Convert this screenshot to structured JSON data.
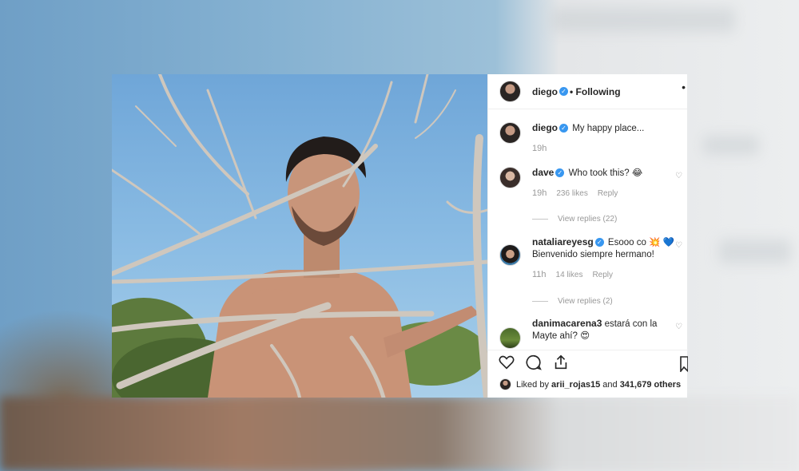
{
  "post": {
    "author": "diego",
    "follow_status": "• Following",
    "more_icon": "more-dots-icon",
    "caption": "My happy place...",
    "caption_time": "19h",
    "comments": [
      {
        "user": "dave",
        "verified": true,
        "text": "Who took this? 😂",
        "time": "19h",
        "likes": "236 likes",
        "reply": "Reply",
        "view_replies": "View replies (22)"
      },
      {
        "user": "nataliareyesg",
        "verified": true,
        "text": "Esooo co 💥 💙 Bienvenido siempre hermano!",
        "time": "11h",
        "likes": "14 likes",
        "reply": "Reply",
        "view_replies": "View replies (2)"
      },
      {
        "user": "danimacarena3",
        "verified": false,
        "text": "estará con la Mayte ahí? 😍"
      }
    ],
    "liked_by": {
      "prefix": "Liked by",
      "user": "arii_rojas15",
      "middle": "and",
      "count": "341,679 others"
    }
  },
  "icons": {
    "like": "heart-icon",
    "comment": "comment-bubble-icon",
    "share": "share-icon",
    "save": "bookmark-icon",
    "verified": "verified-badge-icon"
  },
  "colors": {
    "verified_blue": "#3897f0",
    "text_primary": "#262626",
    "text_secondary": "#999999"
  }
}
